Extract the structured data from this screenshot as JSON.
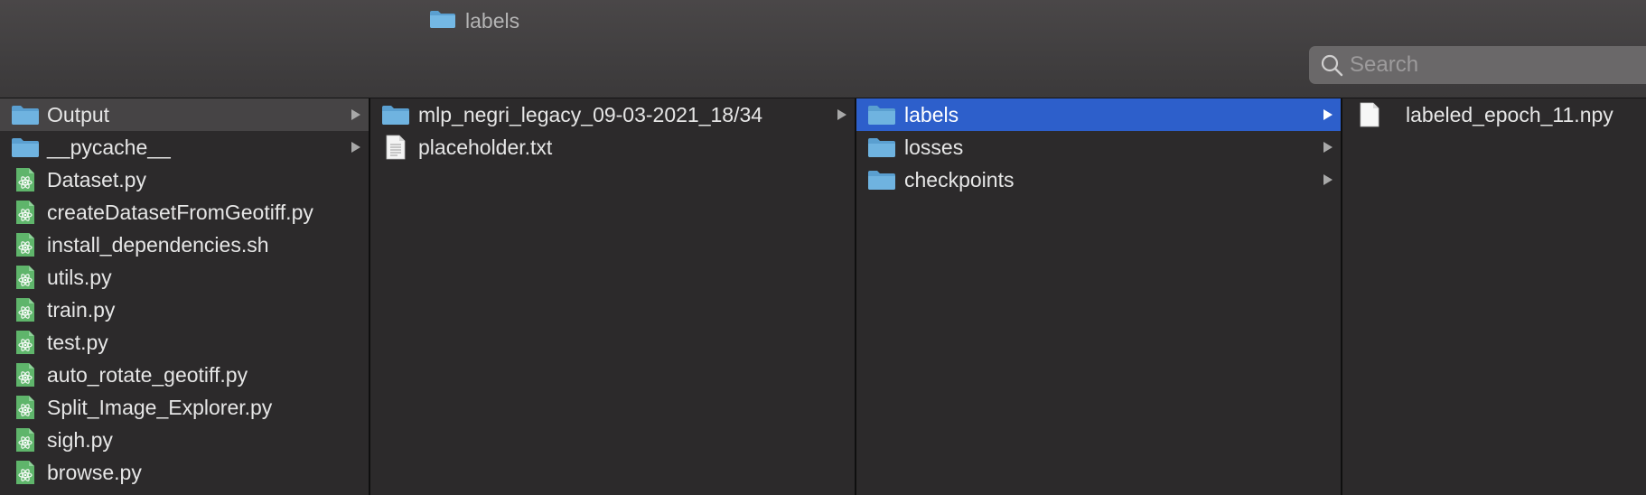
{
  "window": {
    "title": "labels"
  },
  "search": {
    "placeholder": "Search",
    "value": ""
  },
  "columns": [
    {
      "items": [
        {
          "label": "Output",
          "type": "folder",
          "has_children": true,
          "state": "parent-selected"
        },
        {
          "label": "__pycache__",
          "type": "folder",
          "has_children": true,
          "state": ""
        },
        {
          "label": "Dataset.py",
          "type": "python-file",
          "has_children": false,
          "state": ""
        },
        {
          "label": "createDatasetFromGeotiff.py",
          "type": "python-file",
          "has_children": false,
          "state": ""
        },
        {
          "label": "install_dependencies.sh",
          "type": "python-file",
          "has_children": false,
          "state": ""
        },
        {
          "label": "utils.py",
          "type": "python-file",
          "has_children": false,
          "state": ""
        },
        {
          "label": "train.py",
          "type": "python-file",
          "has_children": false,
          "state": ""
        },
        {
          "label": "test.py",
          "type": "python-file",
          "has_children": false,
          "state": ""
        },
        {
          "label": "auto_rotate_geotiff.py",
          "type": "python-file",
          "has_children": false,
          "state": ""
        },
        {
          "label": "Split_Image_Explorer.py",
          "type": "python-file",
          "has_children": false,
          "state": ""
        },
        {
          "label": "sigh.py",
          "type": "python-file",
          "has_children": false,
          "state": ""
        },
        {
          "label": "browse.py",
          "type": "python-file",
          "has_children": false,
          "state": ""
        }
      ]
    },
    {
      "items": [
        {
          "label": "mlp_negri_legacy_09-03-2021_18/34",
          "type": "folder",
          "has_children": true,
          "state": ""
        },
        {
          "label": "placeholder.txt",
          "type": "text-file",
          "has_children": false,
          "state": ""
        }
      ]
    },
    {
      "items": [
        {
          "label": "labels",
          "type": "folder",
          "has_children": true,
          "state": "active-selected"
        },
        {
          "label": "losses",
          "type": "folder",
          "has_children": true,
          "state": ""
        },
        {
          "label": "checkpoints",
          "type": "folder",
          "has_children": true,
          "state": ""
        }
      ]
    },
    {
      "items": [
        {
          "label": "labeled_epoch_11.npy",
          "type": "blank-file",
          "has_children": false,
          "state": ""
        }
      ]
    }
  ],
  "colors": {
    "folder": "#6fb3e0",
    "folder_tab": "#5a9fd0",
    "selection_active": "#2d5fcb",
    "selection_inactive": "#464445",
    "python_icon": "#5fb56b",
    "text": "#e6e6e6"
  }
}
